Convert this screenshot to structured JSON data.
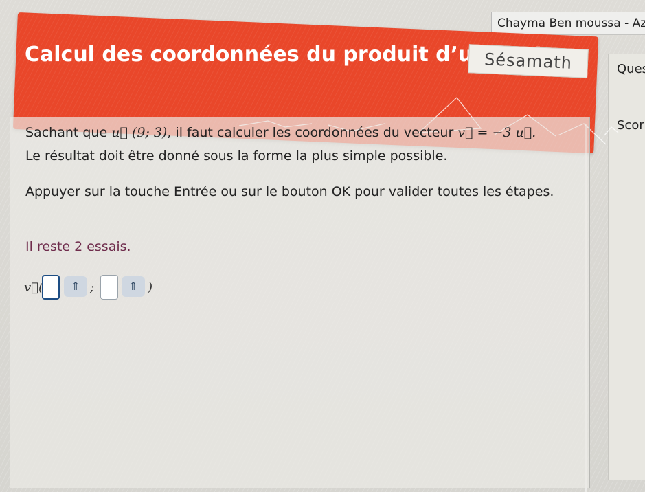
{
  "user_name": "Chayma Ben moussa - Aziri",
  "brand": {
    "name": "Sésamath"
  },
  "title": "Calcul des coordonnées du produit d’un vecteur",
  "sidebar": {
    "question_label": "Ques",
    "score_label": "Scor"
  },
  "exercise": {
    "line1": {
      "prefix": "Sachant que",
      "vector_u": "u⃗",
      "coords": "(9; 3)",
      "middle": ", il faut calculer les coordonnées du vecteur",
      "equation": "v⃗ = −3 u⃗."
    },
    "line2": "Le résultat doit être donné sous la forme la plus simple possible.",
    "instruction": "Appuyer sur la touche Entrée ou sur le bouton OK pour valider toutes les étapes.",
    "attempts": "Il reste 2 essais."
  },
  "answer": {
    "vector_label": "v⃗(",
    "separator": ";",
    "closing": ")",
    "x_value": "",
    "y_value": "",
    "spinner_symbol": "⇑"
  },
  "colors": {
    "header": "#e9472a",
    "attempts_text": "#6f2c4c",
    "input_border": "#1d4d84"
  }
}
